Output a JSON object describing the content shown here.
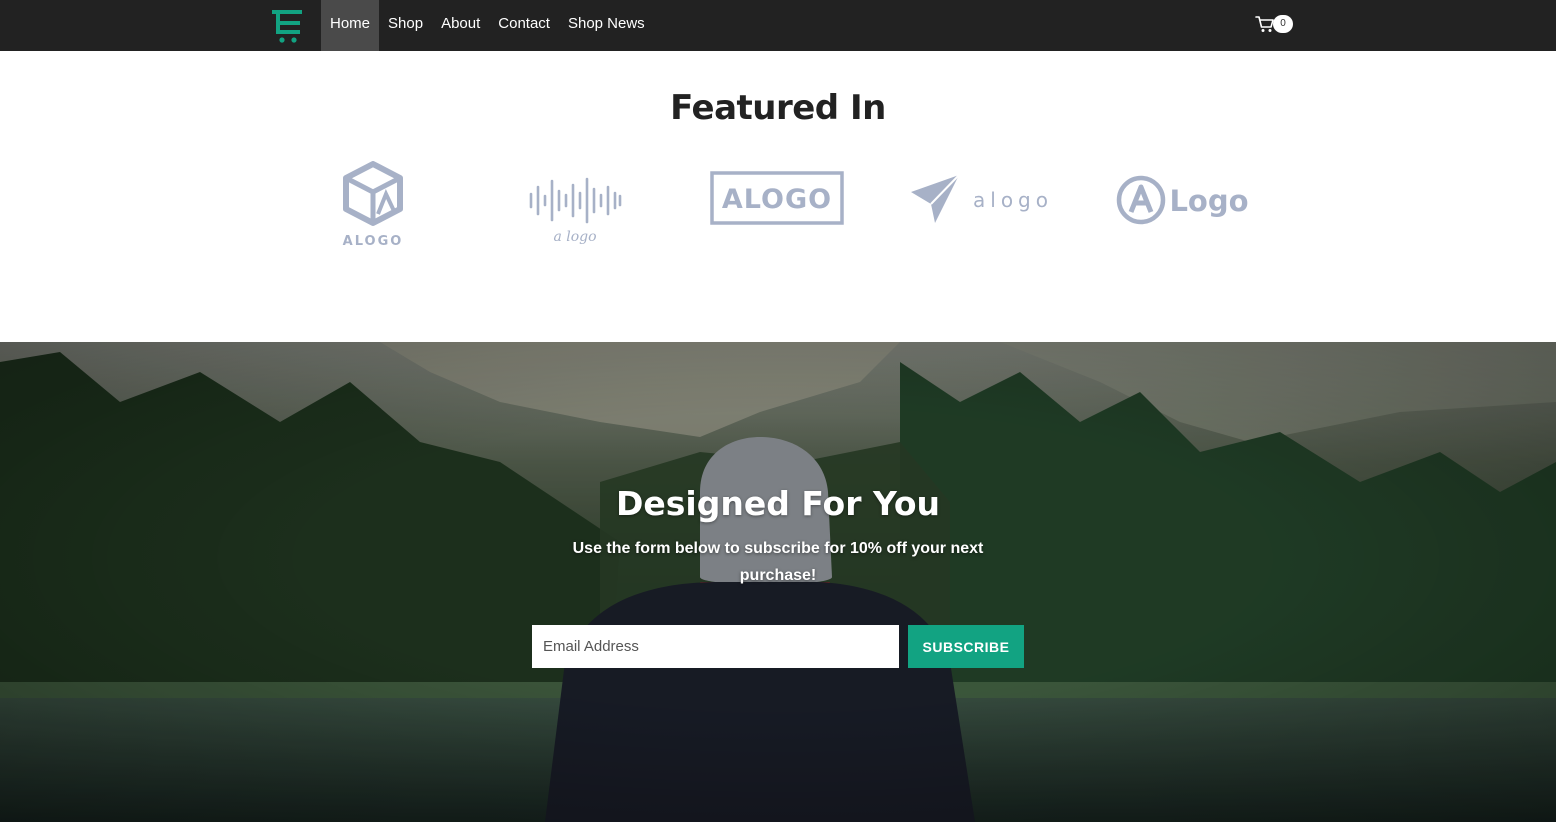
{
  "colors": {
    "navbar_bg": "#222222",
    "brand_accent": "#12a382",
    "logo_gray": "#a7b1c7",
    "subscribe_bg": "#12a382"
  },
  "nav": {
    "brand_icon": "shop-cart-logo-icon",
    "links": [
      {
        "label": "Home",
        "active": true
      },
      {
        "label": "Shop"
      },
      {
        "label": "About"
      },
      {
        "label": "Contact"
      },
      {
        "label": "Shop News"
      }
    ],
    "cart": {
      "icon": "cart-icon",
      "count": "0"
    }
  },
  "featured": {
    "title": "Featured In",
    "logos": [
      {
        "icon": "cube-logo-icon",
        "text": "ALOGO"
      },
      {
        "icon": "soundwave-logo-icon",
        "text": "a logo"
      },
      {
        "icon": "boxed-logo-icon",
        "text": "ALOGO"
      },
      {
        "icon": "paper-plane-logo-icon",
        "text": "alogo"
      },
      {
        "icon": "circle-a-logo-icon",
        "text": "Logo"
      }
    ]
  },
  "hero": {
    "title": "Designed For You",
    "subtitle": "Use the form below to subscribe for 10% off your next purchase!",
    "email_placeholder": "Email Address",
    "subscribe_label": "SUBSCRIBE"
  }
}
